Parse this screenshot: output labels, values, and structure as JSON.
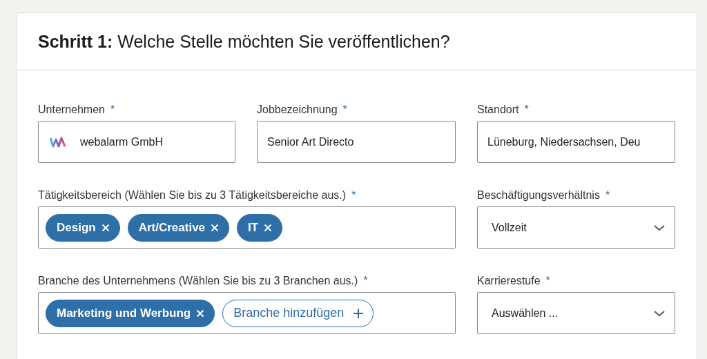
{
  "heading": {
    "step": "Schritt 1:",
    "title": "Welche Stelle möchten Sie veröffentlichen?"
  },
  "fields": [
    {
      "kind": "company",
      "label": "Unternehmen",
      "mark": "*",
      "value": "webalarm GmbH"
    },
    {
      "kind": "text",
      "label": "Jobbezeichnung",
      "mark": "*",
      "value": "Senior Art Directo"
    },
    {
      "kind": "text",
      "label": "Standort",
      "mark": "*",
      "value": "Lüneburg, Niedersachsen, Deu"
    },
    {
      "kind": "chips",
      "label": "Tätigkeitsbereich (Wählen Sie bis zu 3 Tätigkeitsbereiche aus.)",
      "mark": "*",
      "chips": [
        "Design",
        "Art/Creative",
        "IT"
      ]
    },
    {
      "kind": "select",
      "label": "Beschäftigungsverhältnis",
      "mark": "*",
      "value": "Vollzeit"
    },
    {
      "kind": "chips",
      "label": "Branche des Unternehmens (Wählen Sie bis zu 3 Branchen aus.)",
      "mark": "*",
      "chips": [
        "Marketing und Werbung"
      ],
      "add": "Branche hinzufügen"
    },
    {
      "kind": "select",
      "label": "Karrierestufe",
      "mark": "*",
      "value": "Auswählen ..."
    }
  ]
}
